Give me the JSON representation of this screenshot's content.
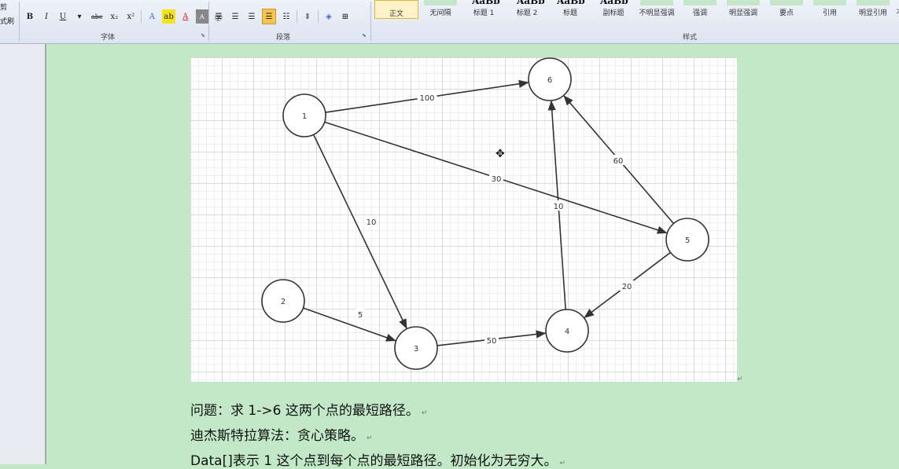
{
  "ribbon": {
    "left_labels": [
      "剪",
      "式刷"
    ],
    "font_group_label": "字体",
    "paragraph_group_label": "段落",
    "styles_group_label": "样式",
    "format_buttons": [
      "B",
      "I",
      "U",
      "abc",
      "x₂",
      "x²"
    ],
    "style_preview": "AaBb",
    "styles": [
      "正文",
      "无间隔",
      "标题 1",
      "标题 2",
      "标题",
      "副标题",
      "不明显强调",
      "强调",
      "明显强调",
      "要点",
      "引用",
      "明显引用",
      "不"
    ],
    "selected_style": "正文",
    "colors": {
      "highlight": "#f3e31a",
      "font_color": "#e11b1b",
      "selected_style": "#fff3c9"
    }
  },
  "graph": {
    "nodes": [
      {
        "id": "1",
        "label": "1"
      },
      {
        "id": "2",
        "label": "2"
      },
      {
        "id": "3",
        "label": "3"
      },
      {
        "id": "4",
        "label": "4"
      },
      {
        "id": "5",
        "label": "5"
      },
      {
        "id": "6",
        "label": "6"
      }
    ],
    "edges": [
      {
        "from": "1",
        "to": "6",
        "weight": "100"
      },
      {
        "from": "1",
        "to": "3",
        "weight": "10"
      },
      {
        "from": "1",
        "to": "5",
        "weight": "30"
      },
      {
        "from": "2",
        "to": "3",
        "weight": "5"
      },
      {
        "from": "3",
        "to": "4",
        "weight": "50"
      },
      {
        "from": "4",
        "to": "6",
        "weight": "10"
      },
      {
        "from": "5",
        "to": "6",
        "weight": "60"
      },
      {
        "from": "5",
        "to": "4",
        "weight": "20"
      }
    ]
  },
  "document": {
    "lines": [
      "问题：求 1->6 这两个点的最短路径。",
      "迪杰斯特拉算法：贪心策略。",
      "Data[]表示 1 这个点到每个点的最短路径。初始化为无穷大。"
    ],
    "paragraph_mark": "↵"
  }
}
